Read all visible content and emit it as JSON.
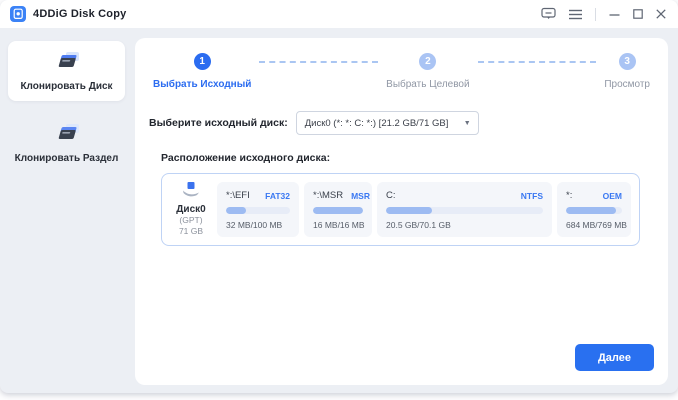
{
  "window": {
    "title": "4DDiG Disk Copy",
    "controls": {
      "feedback": "feedback",
      "menu": "menu",
      "minimize": "minimize",
      "maximize": "maximize",
      "close": "close"
    }
  },
  "sidebar": {
    "items": [
      {
        "label": "Клонировать Диск",
        "active": true
      },
      {
        "label": "Клонировать Раздел",
        "active": false
      }
    ]
  },
  "stepper": {
    "steps": [
      {
        "number": "1",
        "label": "Выбрать Исходный",
        "active": true
      },
      {
        "number": "2",
        "label": "Выбрать Целевой",
        "active": false
      },
      {
        "number": "3",
        "label": "Просмотр",
        "active": false
      }
    ]
  },
  "source_select": {
    "label": "Выберите исходный диск:",
    "selected": "Диск0 (*: *: C: *:) [21.2 GB/71 GB]"
  },
  "disk_layout": {
    "title": "Расположение исходного диска:",
    "disk": {
      "name": "Диск0",
      "scheme": "(GPT)",
      "size": "71 GB"
    },
    "partitions": [
      {
        "name": "*:\\EFI",
        "fs": "FAT32",
        "usage": "32 MB/100 MB",
        "percent": 32
      },
      {
        "name": "*:\\MSR",
        "fs": "MSR",
        "usage": "16 MB/16 MB",
        "percent": 100
      },
      {
        "name": "C:",
        "fs": "NTFS",
        "usage": "20.5 GB/70.1 GB",
        "percent": 29
      },
      {
        "name": "*:",
        "fs": "OEM",
        "usage": "684 MB/769 MB",
        "percent": 89
      }
    ]
  },
  "footer": {
    "next_label": "Далее"
  },
  "colors": {
    "primary": "#2b6cf0",
    "step_inactive": "#aac4f4",
    "bar_fill": "#9dbbf2",
    "bar_track": "#e7ecf7",
    "fs_label": "#3a78f2",
    "panel_bg": "#ffffff",
    "app_bg": "#eceff4",
    "layout_border": "#bfd3f5"
  }
}
